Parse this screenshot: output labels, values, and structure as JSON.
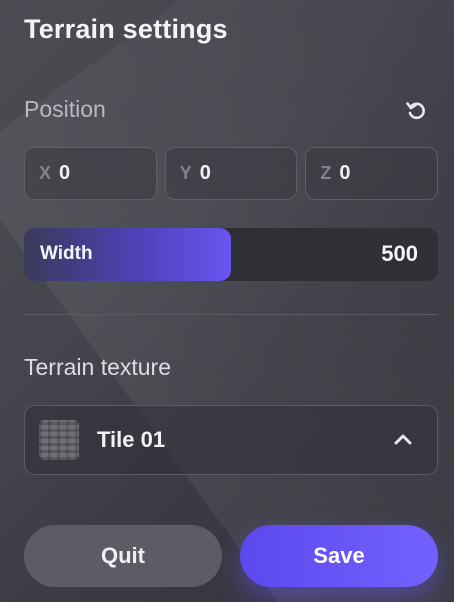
{
  "panel": {
    "title": "Terrain settings"
  },
  "position": {
    "label": "Position",
    "reset_icon": "reset-rotate-icon",
    "fields": [
      {
        "axis": "X",
        "value": "0"
      },
      {
        "axis": "Y",
        "value": "0"
      },
      {
        "axis": "Z",
        "value": "0"
      }
    ]
  },
  "width_slider": {
    "label": "Width",
    "value": "500",
    "fill_fraction": 0.5
  },
  "texture": {
    "label": "Terrain texture",
    "selected": "Tile 01",
    "thumbnail_icon": "tile-texture-thumbnail",
    "chevron_icon": "chevron-up-icon"
  },
  "actions": {
    "quit_label": "Quit",
    "save_label": "Save"
  },
  "colors": {
    "accent": "#6a55f0",
    "panel_bg": "#45454d",
    "quit_bg": "#5c5d64"
  }
}
